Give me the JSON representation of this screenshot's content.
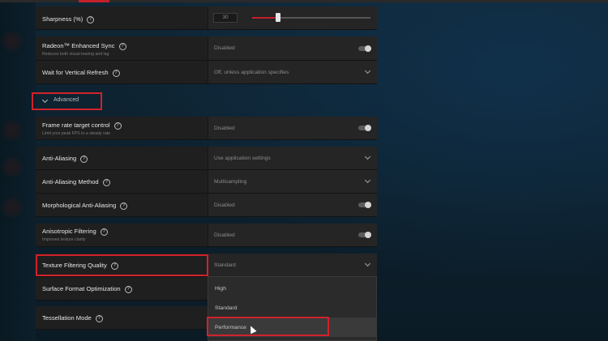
{
  "settings": {
    "sharpness": {
      "label": "Sharpness (%)",
      "value": "30",
      "slider_fraction": 0.22
    },
    "enhanced_sync": {
      "label": "Radeon™ Enhanced Sync",
      "sub": "Reduces both visual tearing and lag",
      "value": "Disabled"
    },
    "vertical_refresh": {
      "label": "Wait for Vertical Refresh",
      "value": "Off, unless application specifies"
    },
    "advanced": {
      "label": "Advanced"
    },
    "frame_rate": {
      "label": "Frame rate target control",
      "sub": "Limit your peak FPS to a steady rate",
      "value": "Disabled"
    },
    "anti_aliasing": {
      "label": "Anti-Aliasing",
      "value": "Use application settings"
    },
    "aa_method": {
      "label": "Anti-Aliasing Method",
      "value": "Multisampling"
    },
    "morph_aa": {
      "label": "Morphological Anti-Aliasing",
      "value": "Disabled"
    },
    "anisotropic": {
      "label": "Anisotropic Filtering",
      "sub": "Improves texture clarity",
      "value": "Disabled"
    },
    "texture_quality": {
      "label": "Texture Filtering Quality",
      "value": "Standard"
    },
    "surface_format": {
      "label": "Surface Format Optimization"
    },
    "tessellation": {
      "label": "Tessellation Mode"
    }
  },
  "dropdown": {
    "options": [
      "High",
      "Standard",
      "Performance"
    ],
    "hovered": "Performance"
  },
  "icons": {
    "help": "?"
  },
  "colors": {
    "accent": "#d1222b",
    "panel": "#1f1f1f",
    "background": "#0e1f2b"
  }
}
